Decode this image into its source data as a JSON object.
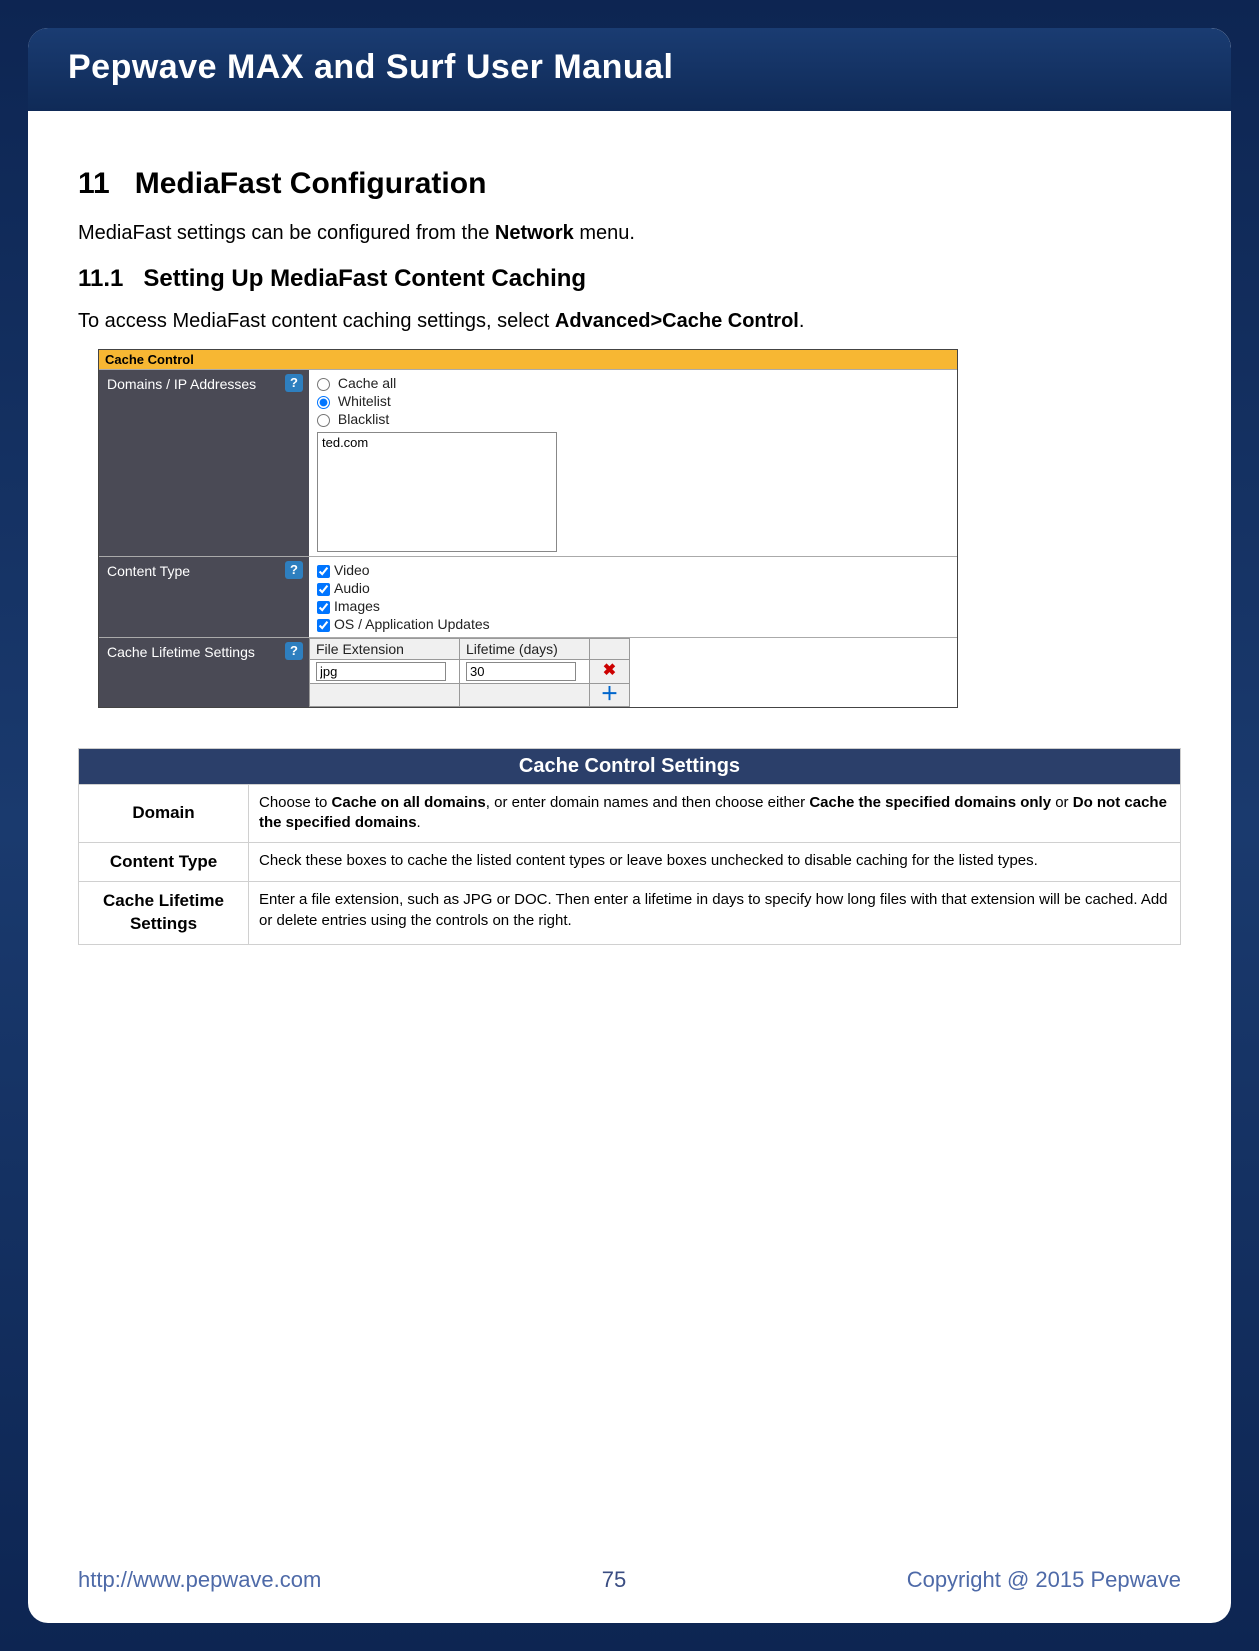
{
  "header": {
    "title": "Pepwave MAX and Surf User Manual"
  },
  "section": {
    "number": "11",
    "title": "MediaFast Configuration"
  },
  "subsection": {
    "number": "11.1",
    "title": "Setting Up MediaFast Content Caching"
  },
  "intro_parts": {
    "p1a": "MediaFast settings can be configured from the ",
    "p1b": "Network",
    "p1c": " menu.",
    "p2a": "To access MediaFast content caching settings, select ",
    "p2b": "Advanced>Cache Control",
    "p2c": "."
  },
  "screenshot": {
    "title": "Cache Control",
    "rows": {
      "domains": {
        "label": "Domains / IP Addresses",
        "radios": [
          "Cache all",
          "Whitelist",
          "Blacklist"
        ],
        "selected": "Whitelist",
        "textarea_value": "ted.com"
      },
      "content_type": {
        "label": "Content Type",
        "checks": [
          "Video",
          "Audio",
          "Images",
          "OS / Application Updates"
        ]
      },
      "lifetime": {
        "label": "Cache Lifetime Settings",
        "headers": [
          "File Extension",
          "Lifetime (days)"
        ],
        "ext": "jpg",
        "days": "30"
      }
    },
    "help_glyph": "?"
  },
  "settings_table": {
    "caption": "Cache Control Settings",
    "rows": [
      {
        "k": "Domain",
        "v_parts": [
          "Choose to ",
          "Cache on all domains",
          ", or enter domain names and then choose either ",
          "Cache the specified domains only",
          " or ",
          "Do not cache the specified domains",
          "."
        ]
      },
      {
        "k": "Content Type",
        "v": "Check these boxes to cache the listed content types or leave boxes unchecked to disable caching for the listed types."
      },
      {
        "k": "Cache Lifetime Settings",
        "v": "Enter a file extension, such as JPG or DOC. Then enter a lifetime in days to specify how long files with that extension will be cached. Add or delete entries using the controls on the right."
      }
    ]
  },
  "footer": {
    "url": "http://www.pepwave.com",
    "page": "75",
    "copyright": "Copyright @ 2015 Pepwave"
  }
}
